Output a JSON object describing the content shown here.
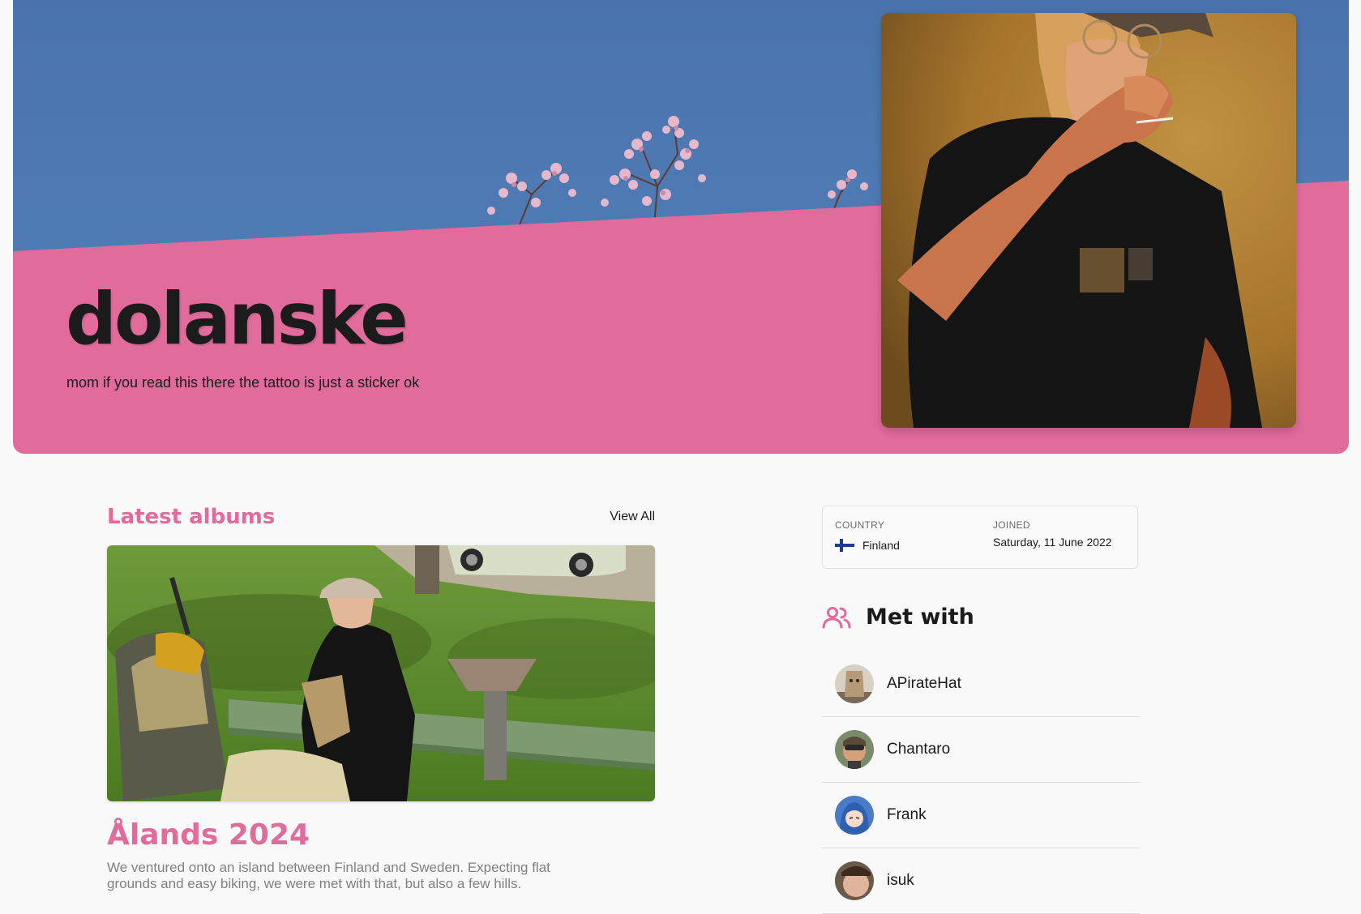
{
  "profile": {
    "username": "dolanske",
    "bio": "mom if you read this there the tattoo is just a sticker ok"
  },
  "albums": {
    "section_title": "Latest albums",
    "view_all_label": "View All",
    "items": [
      {
        "title": "Ålands 2024",
        "description": "We ventured onto an island between Finland and Sweden. Expecting flat grounds and easy biking, we were met with that, but also a few hills."
      }
    ]
  },
  "info": {
    "country_label": "COUNTRY",
    "country_value": "Finland",
    "joined_label": "JOINED",
    "joined_value": "Saturday, 11 June 2022"
  },
  "met_with": {
    "title": "Met with",
    "icon": "users-icon",
    "people": [
      {
        "name": "APirateHat"
      },
      {
        "name": "Chantaro"
      },
      {
        "name": "Frank"
      },
      {
        "name": "isuk"
      }
    ]
  },
  "colors": {
    "accent": "#e16b9b",
    "sky": "#4a73ad",
    "background": "#f9f9f9"
  }
}
